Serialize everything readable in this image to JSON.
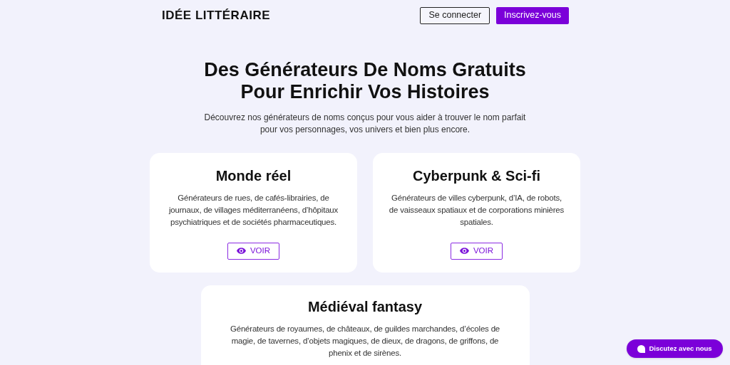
{
  "header": {
    "logo": "IDÉE LITTÉRAIRE",
    "buttons": [
      {
        "label": "Se connecter",
        "kind": "outline"
      },
      {
        "label": "Inscrivez-vous",
        "kind": "primary"
      }
    ]
  },
  "hero": {
    "title_lines": [
      "Des Générateurs De Noms Gratuits",
      "Pour Enrichir Vos Histoires"
    ],
    "subtitle": "Découvrez nos générateurs de noms conçus pour vous aider à trouver le nom parfait pour vos personnages, vos univers et bien plus encore."
  },
  "cards": [
    {
      "title": "Monde réel",
      "description": "Générateurs de rues, de cafés-librairies, de journaux, de villages méditerranéens, d’hôpitaux psychiatriques et de sociétés pharmaceutiques.",
      "button": "VOIR"
    },
    {
      "title": "Cyberpunk & Sci-fi",
      "description": "Générateurs de villes cyberpunk, d’IA, de robots, de vaisseaux spatiaux et de corporations minières spatiales.",
      "button": "VOIR"
    },
    {
      "title": "Médiéval fantasy",
      "description": "Générateurs de royaumes, de châteaux, de guildes marchandes, d’écoles de magie, de tavernes, d’objets magiques, de dieux, de dragons, de griffons, de phenix et de sirènes."
    }
  ],
  "chat_button": "Discutez avec nous"
}
